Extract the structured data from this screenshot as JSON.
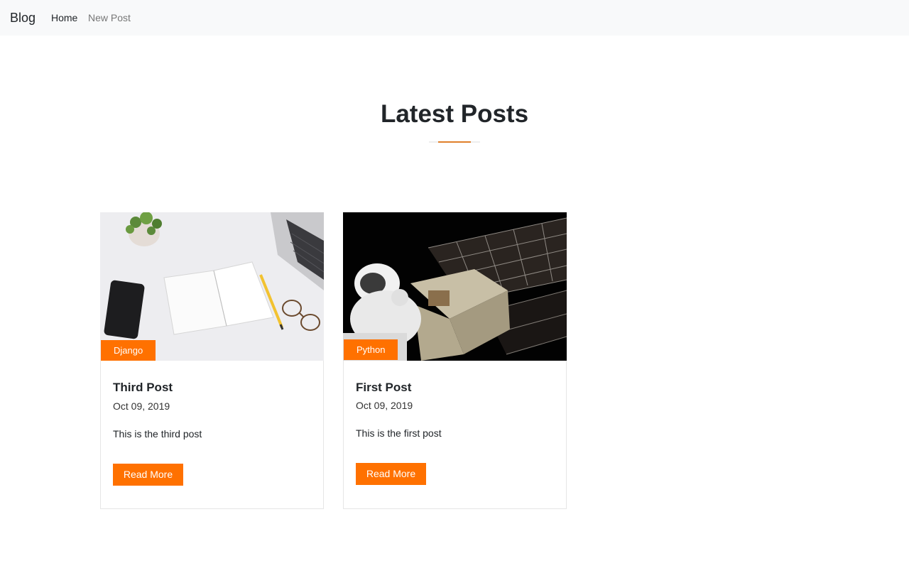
{
  "navbar": {
    "brand": "Blog",
    "links": [
      {
        "label": "Home",
        "active": true
      },
      {
        "label": "New Post",
        "active": false
      }
    ]
  },
  "main": {
    "section_title": "Latest Posts",
    "posts": [
      {
        "category": "Django",
        "title": "Third Post",
        "date": "Oct 09, 2019",
        "excerpt": "This is the third post",
        "button": "Read More",
        "image": "desk-notebook-image"
      },
      {
        "category": "Python",
        "title": "First Post",
        "date": "Oct 09, 2019",
        "excerpt": "This is the first post",
        "button": "Read More",
        "image": "astronaut-space-image"
      }
    ]
  },
  "colors": {
    "accent": "#ff7100",
    "navbar_bg": "#f8f9fa"
  }
}
